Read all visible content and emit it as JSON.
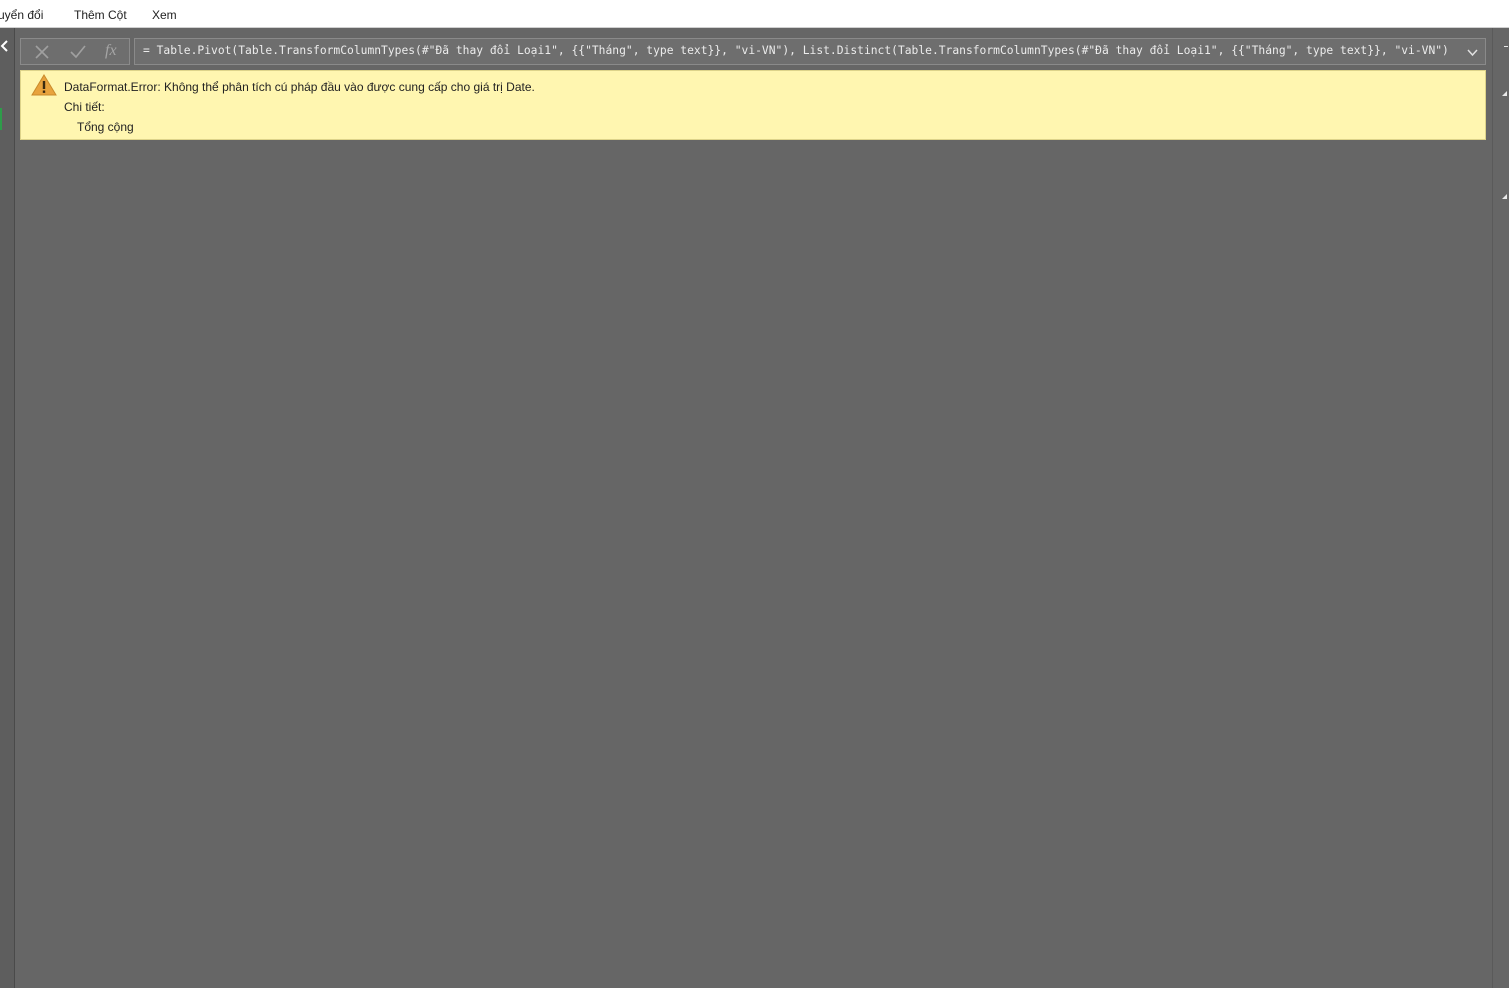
{
  "ribbon": {
    "tabs": [
      "uyển đổi",
      "Thêm Cột",
      "Xem"
    ]
  },
  "formula_bar": {
    "formula": "= Table.Pivot(Table.TransformColumnTypes(#\"Đã thay đổi Loại1\", {{\"Tháng\", type text}}, \"vi-VN\"), List.Distinct(Table.TransformColumnTypes(#\"Đã thay đổi Loại1\", {{\"Tháng\", type text}}, \"vi-VN\")",
    "fx_label": "fx",
    "icons": [
      "cancel-icon",
      "confirm-icon",
      "fx-icon",
      "expand-icon"
    ]
  },
  "error": {
    "message": "DataFormat.Error: Không thể phân tích cú pháp đầu vào được cung cấp cho giá trị Date.",
    "details_label": "Chi tiết:",
    "detail_value": "Tổng cộng",
    "icon": "warning-icon"
  },
  "colors": {
    "canvas": "#666666",
    "banner_background": "#fff6b0",
    "warning_icon": "#e8a33d",
    "formula_background": "#6e6e6e"
  }
}
